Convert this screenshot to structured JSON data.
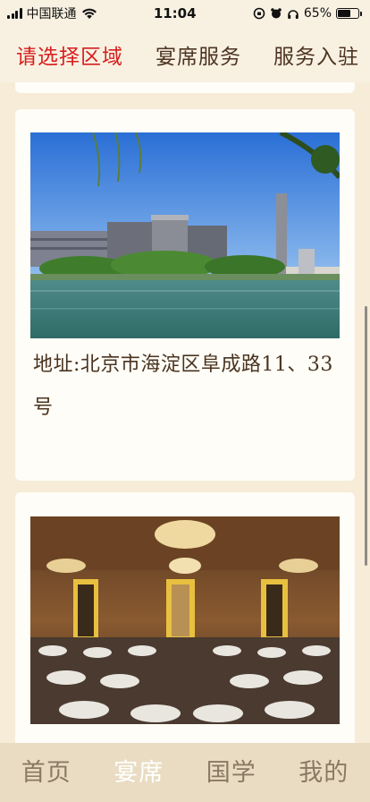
{
  "status_bar": {
    "carrier": "中国联通",
    "time": "11:04",
    "battery_percent": "65%",
    "battery_level": 0.65
  },
  "top_nav": {
    "tabs": [
      {
        "label": "请选择区域",
        "active": true
      },
      {
        "label": "宴席服务",
        "active": false
      },
      {
        "label": "服务入驻",
        "active": false
      }
    ]
  },
  "cards": [
    {
      "image": "campus-lake-photo",
      "address": "地址:北京市海淀区阜成路11、33号"
    },
    {
      "image": "banquet-hall-photo"
    }
  ],
  "bottom_nav": {
    "tabs": [
      {
        "label": "首页",
        "active": false
      },
      {
        "label": "宴席",
        "active": true
      },
      {
        "label": "国学",
        "active": false
      },
      {
        "label": "我的",
        "active": false
      }
    ]
  },
  "colors": {
    "accent_red": "#d81e1e",
    "background": "#f6ecd7",
    "tab_bar": "#e9dcc2"
  }
}
